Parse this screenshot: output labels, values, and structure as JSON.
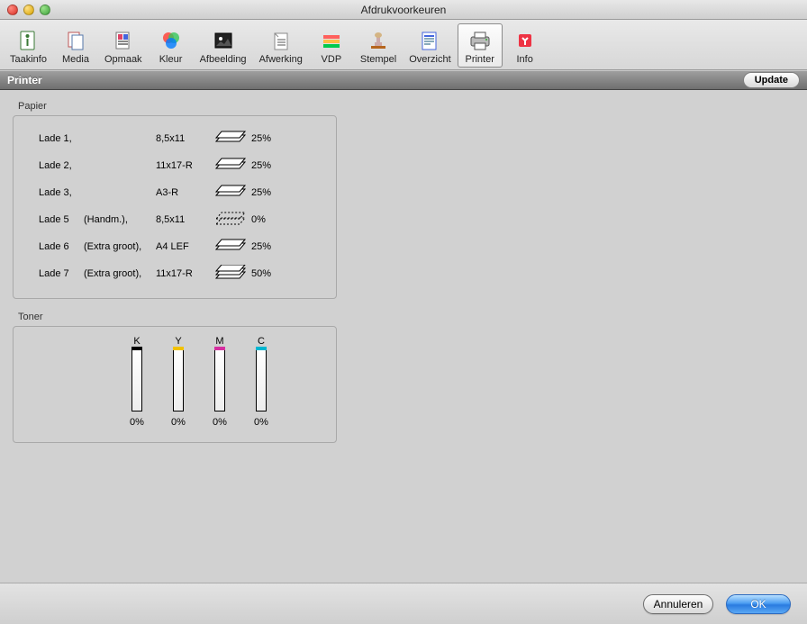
{
  "window": {
    "title": "Afdrukvoorkeuren"
  },
  "toolbar": {
    "items": [
      {
        "id": "taakinfo",
        "label": "Taakinfo"
      },
      {
        "id": "media",
        "label": "Media"
      },
      {
        "id": "opmaak",
        "label": "Opmaak"
      },
      {
        "id": "kleur",
        "label": "Kleur"
      },
      {
        "id": "afbeelding",
        "label": "Afbeelding"
      },
      {
        "id": "afwerking",
        "label": "Afwerking"
      },
      {
        "id": "vdp",
        "label": "VDP"
      },
      {
        "id": "stempel",
        "label": "Stempel"
      },
      {
        "id": "overzicht",
        "label": "Overzicht"
      },
      {
        "id": "printer",
        "label": "Printer",
        "selected": true
      },
      {
        "id": "info",
        "label": "Info"
      }
    ]
  },
  "section": {
    "title": "Printer",
    "update_label": "Update"
  },
  "paper": {
    "legend": "Papier",
    "trays": [
      {
        "name": "Lade 1,",
        "note": "",
        "size": "8,5x11",
        "percent": "25%",
        "stack": 1,
        "empty": false
      },
      {
        "name": "Lade 2,",
        "note": "",
        "size": "11x17-R",
        "percent": "25%",
        "stack": 1,
        "empty": false
      },
      {
        "name": "Lade 3,",
        "note": "",
        "size": "A3-R",
        "percent": "25%",
        "stack": 1,
        "empty": false
      },
      {
        "name": "Lade 5",
        "note": "(Handm.),",
        "size": "8,5x11",
        "percent": "0%",
        "stack": 0,
        "empty": true
      },
      {
        "name": "Lade 6",
        "note": "(Extra groot),",
        "size": "A4 LEF",
        "percent": "25%",
        "stack": 1,
        "empty": false
      },
      {
        "name": "Lade 7",
        "note": "(Extra groot),",
        "size": "11x17-R",
        "percent": "50%",
        "stack": 2,
        "empty": false
      }
    ]
  },
  "toner": {
    "legend": "Toner",
    "items": [
      {
        "label": "K",
        "percent": "0%",
        "color": "#000000"
      },
      {
        "label": "Y",
        "percent": "0%",
        "color": "#f2c200"
      },
      {
        "label": "M",
        "percent": "0%",
        "color": "#d62ea0"
      },
      {
        "label": "C",
        "percent": "0%",
        "color": "#00b6d0"
      }
    ]
  },
  "footer": {
    "cancel": "Annuleren",
    "ok": "OK"
  }
}
